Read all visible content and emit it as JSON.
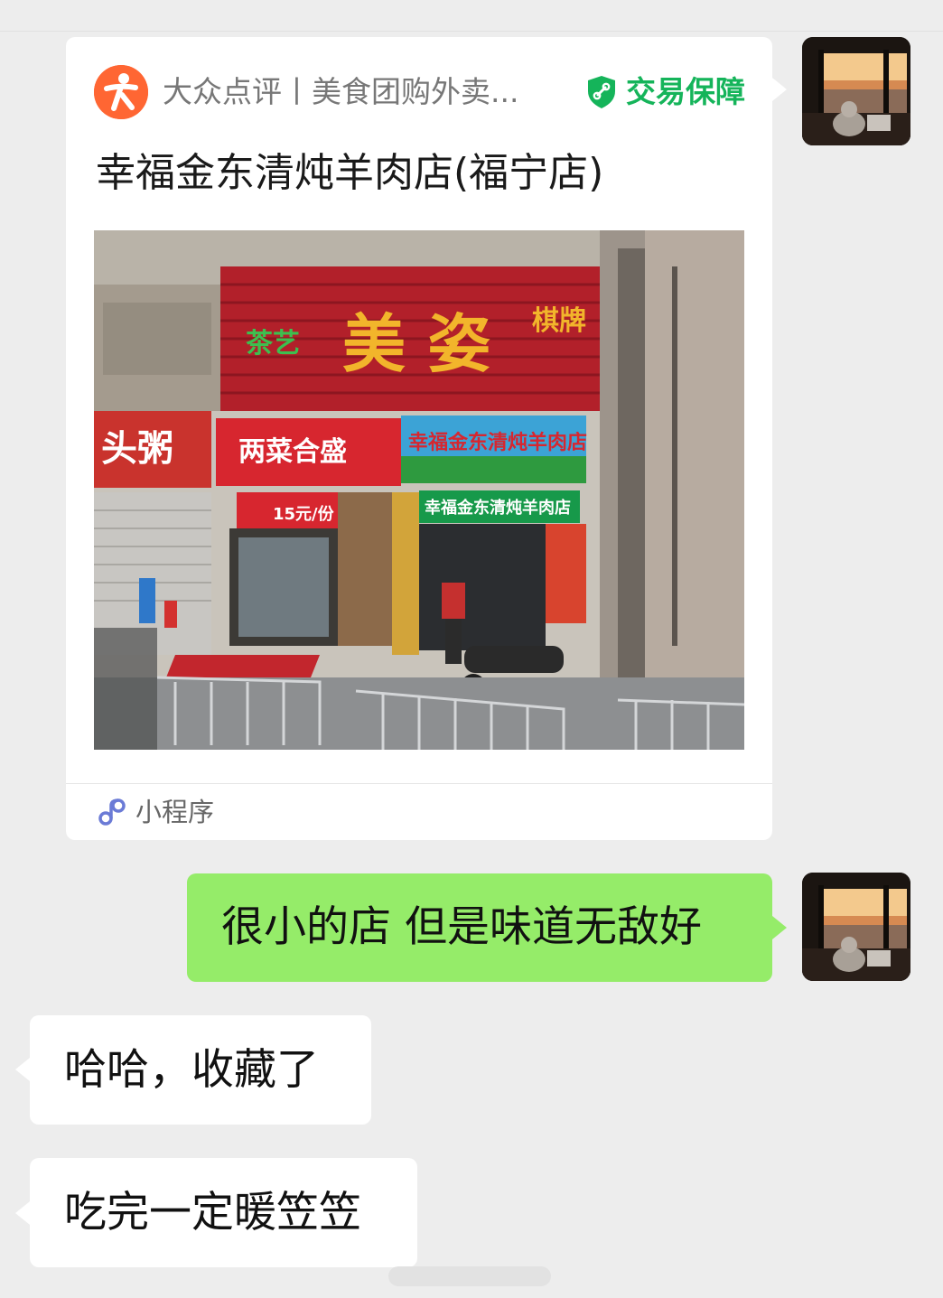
{
  "mini_program_card": {
    "source": "大众点评丨美食团购外卖...",
    "guarantee_label": "交易保障",
    "title": "幸福金东清炖羊肉店(福宁店)",
    "photo_signs": {
      "main_sign": "美 姿",
      "left_side": "茶艺",
      "right_side": "棋牌",
      "shop_left": "两菜合盛",
      "shop_right": "幸福金东清炖羊肉店",
      "shop_right_lower": "幸福金东清炖羊肉店",
      "price_tag": "15元/份",
      "left_shop": "头粥"
    },
    "footer_label": "小程序"
  },
  "messages": [
    {
      "side": "outgoing",
      "text": "很小的店 但是味道无敌好"
    },
    {
      "side": "incoming",
      "text": "哈哈，收藏了"
    },
    {
      "side": "incoming",
      "text": "吃完一定暖笠笠"
    }
  ],
  "colors": {
    "background": "#ededed",
    "outgoing_bubble": "#95ec69",
    "incoming_bubble": "#ffffff",
    "guarantee_green": "#15b45a",
    "dianping_orange": "#ff6633"
  },
  "icons": {
    "avatar": "sunset-window-avatar",
    "source_logo": "dianping-logo",
    "guarantee": "shield-icon",
    "footer": "mini-program-link-icon"
  }
}
